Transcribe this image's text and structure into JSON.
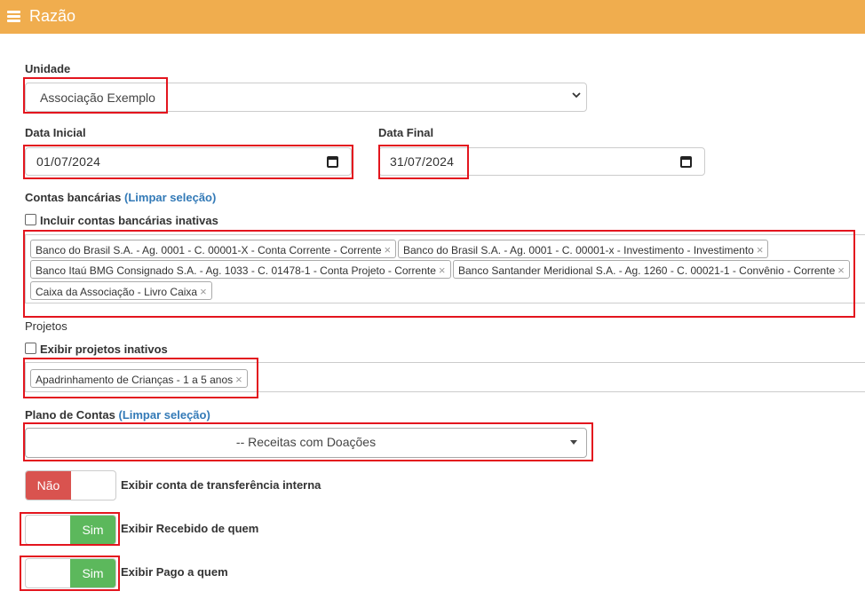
{
  "header": {
    "title": "Razão",
    "menu_icon": "hamburger-menu-icon"
  },
  "form": {
    "unidade": {
      "label": "Unidade",
      "value": "Associação Exemplo"
    },
    "data_inicial": {
      "label": "Data Inicial",
      "value": "01/07/2024"
    },
    "data_final": {
      "label": "Data Final",
      "value": "31/07/2024"
    },
    "contas_bancarias": {
      "label": "Contas bancárias",
      "clear_label": "(Limpar seleção)",
      "include_inactive_label": "Incluir contas bancárias inativas",
      "include_inactive_checked": false,
      "selected": [
        "Banco do Brasil S.A. - Ag. 0001 - C. 00001-X - Conta Corrente - Corrente",
        "Banco do Brasil S.A. - Ag. 0001 - C. 00001-x - Investimento - Investimento",
        "Banco Itaú BMG Consignado S.A. - Ag. 1033 - C. 01478-1 - Conta Projeto - Corrente",
        "Banco Santander Meridional S.A. - Ag. 1260 - C. 00021-1 - Convênio - Corrente",
        "Caixa da Associação - Livro Caixa"
      ]
    },
    "projetos": {
      "label": "Projetos",
      "show_inactive_label": "Exibir projetos inativos",
      "show_inactive_checked": false,
      "selected": [
        "Apadrinhamento de Crianças - 1 a 5 anos"
      ]
    },
    "plano_de_contas": {
      "label": "Plano de Contas",
      "clear_label": "(Limpar seleção)",
      "value": "-- Receitas com Doações"
    },
    "toggles": [
      {
        "state_label": "Não",
        "state": false,
        "label": "Exibir conta de transferência interna"
      },
      {
        "state_label": "Sim",
        "state": true,
        "label": "Exibir Recebido de quem"
      },
      {
        "state_label": "Sim",
        "state": true,
        "label": "Exibir Pago a quem"
      }
    ],
    "chip_remove_glyph": "×"
  },
  "colors": {
    "header_bg": "#f0ad4e",
    "link": "#337ab7",
    "toggle_off": "#d9534f",
    "toggle_on": "#5cb85c",
    "highlight": "#e3151e"
  }
}
